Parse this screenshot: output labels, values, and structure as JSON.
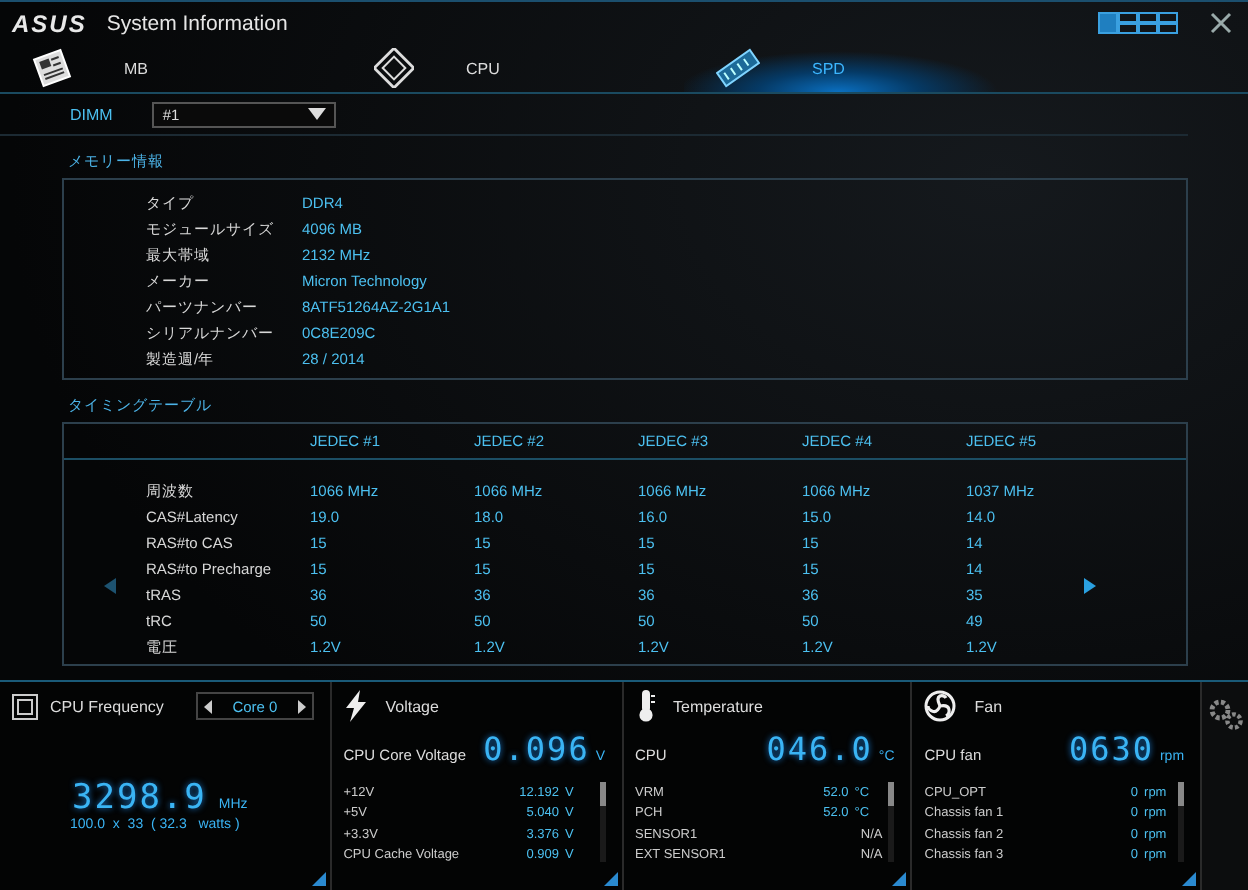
{
  "window": {
    "logo": "ASUS",
    "title": "System Information"
  },
  "tabs": [
    {
      "label": "MB",
      "selected": false,
      "kind": "board"
    },
    {
      "label": "CPU",
      "selected": false,
      "kind": "chip"
    },
    {
      "label": "SPD",
      "selected": true,
      "kind": "ram"
    }
  ],
  "dimm": {
    "label": "DIMM",
    "value": "#1"
  },
  "memory_info": {
    "title": "メモリー情報",
    "rows": [
      {
        "label": "タイプ",
        "value": "DDR4"
      },
      {
        "label": "モジュールサイズ",
        "value": "4096 MB"
      },
      {
        "label": "最大帯域",
        "value": "2132 MHz"
      },
      {
        "label": "メーカー",
        "value": "Micron Technology"
      },
      {
        "label": "パーツナンバー",
        "value": "8ATF51264AZ-2G1A1"
      },
      {
        "label": "シリアルナンバー",
        "value": "0C8E209C"
      },
      {
        "label": "製造週/年",
        "value": "28 / 2014"
      }
    ]
  },
  "timing_table": {
    "title": "タイミングテーブル",
    "columns": [
      "JEDEC #1",
      "JEDEC #2",
      "JEDEC #3",
      "JEDEC #4",
      "JEDEC #5"
    ],
    "rows": [
      {
        "label": "周波数",
        "values": [
          "1066 MHz",
          "1066 MHz",
          "1066 MHz",
          "1066 MHz",
          "1037 MHz"
        ]
      },
      {
        "label": "CAS#Latency",
        "values": [
          "19.0",
          "18.0",
          "16.0",
          "15.0",
          "14.0"
        ]
      },
      {
        "label": "RAS#to CAS",
        "values": [
          "15",
          "15",
          "15",
          "15",
          "14"
        ]
      },
      {
        "label": "RAS#to Precharge",
        "values": [
          "15",
          "15",
          "15",
          "15",
          "14"
        ]
      },
      {
        "label": "tRAS",
        "values": [
          "36",
          "36",
          "36",
          "36",
          "35"
        ]
      },
      {
        "label": "tRC",
        "values": [
          "50",
          "50",
          "50",
          "50",
          "49"
        ]
      },
      {
        "label": "電圧",
        "values": [
          "1.2V",
          "1.2V",
          "1.2V",
          "1.2V",
          "1.2V"
        ]
      }
    ]
  },
  "cpu_frequency": {
    "title": "CPU Frequency",
    "core": "Core 0",
    "value": "3298.9",
    "unit": "MHz",
    "detail": "100.0  x  33  ( 32.3   watts )"
  },
  "monitors": [
    {
      "kind": "voltage",
      "title": "Voltage",
      "main_label": "CPU Core Voltage",
      "value": "0.096",
      "unit": "V",
      "rows": [
        {
          "label": "+12V",
          "value": "12.192",
          "unit": "V"
        },
        {
          "label": "+5V",
          "value": "5.040",
          "unit": "V"
        },
        {
          "label": "+3.3V",
          "value": "3.376",
          "unit": "V"
        },
        {
          "label": "CPU Cache Voltage",
          "value": "0.909",
          "unit": "V"
        }
      ]
    },
    {
      "kind": "temperature",
      "title": "Temperature",
      "main_label": "CPU",
      "value": "046.0",
      "unit": "°C",
      "rows": [
        {
          "label": "VRM",
          "value": "52.0",
          "unit": "°C"
        },
        {
          "label": "PCH",
          "value": "52.0",
          "unit": "°C"
        },
        {
          "label": "SENSOR1",
          "value": "N/A"
        },
        {
          "label": "EXT SENSOR1",
          "value": "N/A"
        }
      ]
    },
    {
      "kind": "fan",
      "title": "Fan",
      "main_label": "CPU fan",
      "value": "0630",
      "unit": "rpm",
      "rows": [
        {
          "label": "CPU_OPT",
          "value": "0",
          "unit": "rpm"
        },
        {
          "label": "Chassis fan 1",
          "value": "0",
          "unit": "rpm"
        },
        {
          "label": "Chassis fan 2",
          "value": "0",
          "unit": "rpm"
        },
        {
          "label": "Chassis fan 3",
          "value": "0",
          "unit": "rpm"
        }
      ]
    }
  ]
}
